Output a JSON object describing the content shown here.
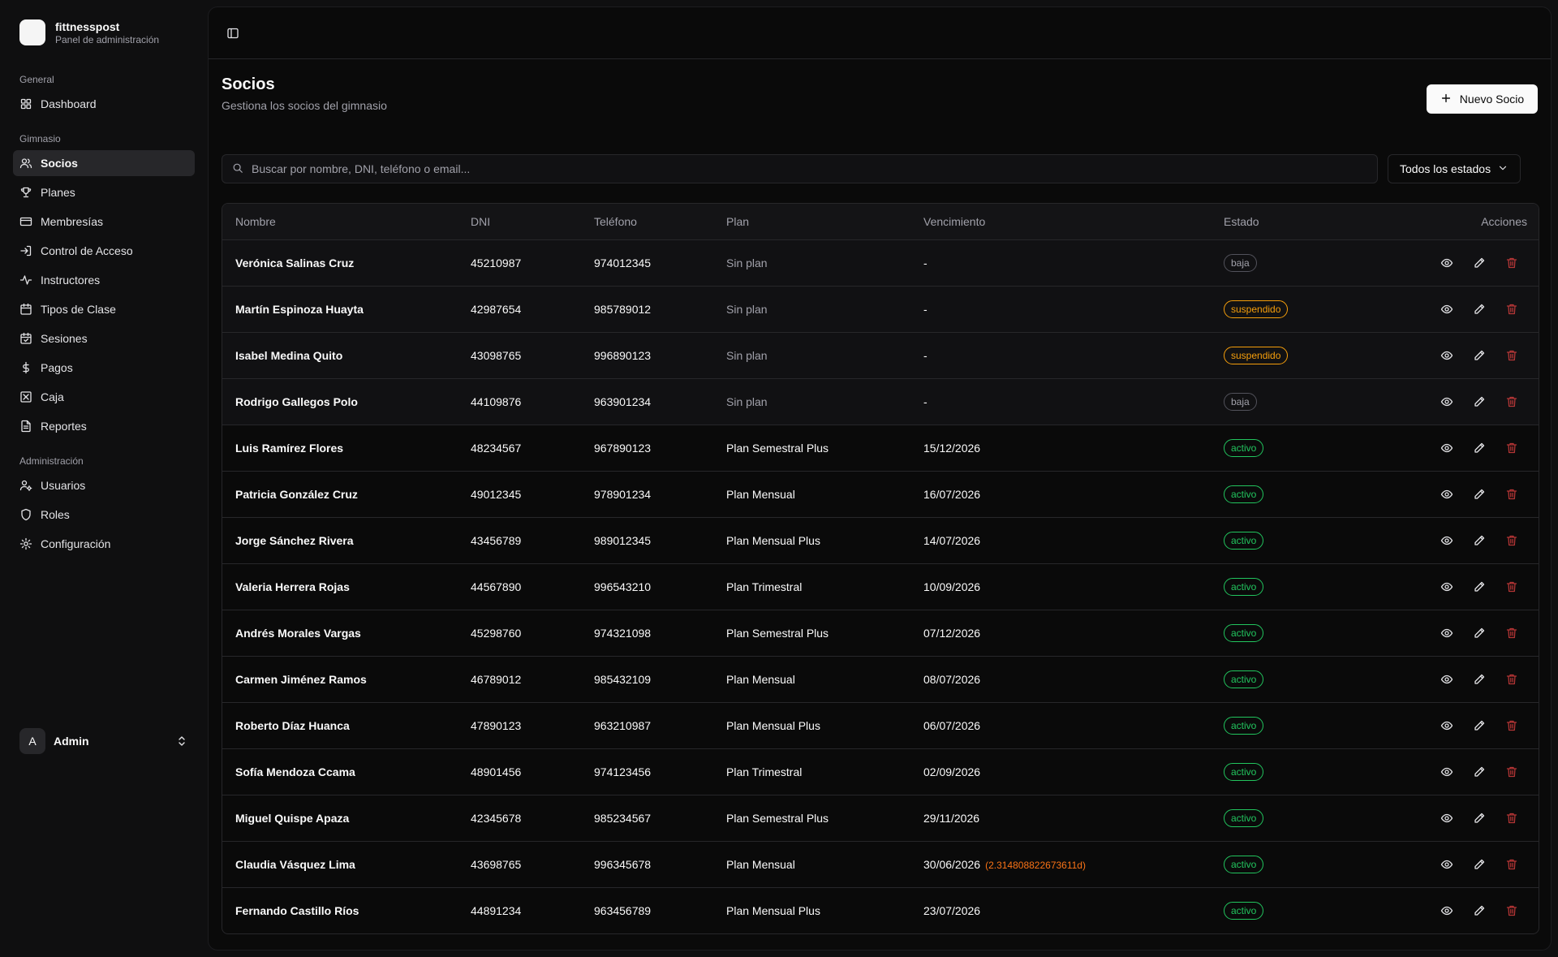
{
  "app": {
    "name": "fittnesspost",
    "subtitle": "Panel de administración"
  },
  "sidebar": {
    "groups": [
      {
        "label": "General",
        "items": [
          {
            "label": "Dashboard",
            "icon": "grid-icon"
          }
        ]
      },
      {
        "label": "Gimnasio",
        "items": [
          {
            "label": "Socios",
            "icon": "users-icon",
            "active": true
          },
          {
            "label": "Planes",
            "icon": "trophy-icon"
          },
          {
            "label": "Membresías",
            "icon": "card-icon"
          },
          {
            "label": "Control de Acceso",
            "icon": "login-icon"
          },
          {
            "label": "Instructores",
            "icon": "activity-icon"
          },
          {
            "label": "Tipos de Clase",
            "icon": "calendar-icon"
          },
          {
            "label": "Sesiones",
            "icon": "calendar-check-icon"
          },
          {
            "label": "Pagos",
            "icon": "dollar-icon"
          },
          {
            "label": "Caja",
            "icon": "cash-box-icon"
          },
          {
            "label": "Reportes",
            "icon": "file-icon"
          }
        ]
      },
      {
        "label": "Administración",
        "items": [
          {
            "label": "Usuarios",
            "icon": "user-cog-icon"
          },
          {
            "label": "Roles",
            "icon": "shield-icon"
          },
          {
            "label": "Configuración",
            "icon": "gear-icon"
          }
        ]
      }
    ],
    "user": {
      "initial": "A",
      "name": "Admin"
    }
  },
  "page": {
    "title": "Socios",
    "subtitle": "Gestiona los socios del gimnasio",
    "new_button": "Nuevo Socio",
    "search_placeholder": "Buscar por nombre, DNI, teléfono o email...",
    "status_filter": "Todos los estados"
  },
  "table": {
    "columns": [
      "Nombre",
      "DNI",
      "Teléfono",
      "Plan",
      "Vencimiento",
      "Estado",
      "Acciones"
    ],
    "rows": [
      {
        "nombre": "Verónica Salinas Cruz",
        "dni": "45210987",
        "telefono": "974012345",
        "plan": "Sin plan",
        "vencimiento": "-",
        "estado": "baja"
      },
      {
        "nombre": "Martín Espinoza Huayta",
        "dni": "42987654",
        "telefono": "985789012",
        "plan": "Sin plan",
        "vencimiento": "-",
        "estado": "suspendido"
      },
      {
        "nombre": "Isabel Medina Quito",
        "dni": "43098765",
        "telefono": "996890123",
        "plan": "Sin plan",
        "vencimiento": "-",
        "estado": "suspendido"
      },
      {
        "nombre": "Rodrigo Gallegos Polo",
        "dni": "44109876",
        "telefono": "963901234",
        "plan": "Sin plan",
        "vencimiento": "-",
        "estado": "baja"
      },
      {
        "nombre": "Luis Ramírez Flores",
        "dni": "48234567",
        "telefono": "967890123",
        "plan": "Plan Semestral Plus",
        "vencimiento": "15/12/2026",
        "estado": "activo"
      },
      {
        "nombre": "Patricia González Cruz",
        "dni": "49012345",
        "telefono": "978901234",
        "plan": "Plan Mensual",
        "vencimiento": "16/07/2026",
        "estado": "activo"
      },
      {
        "nombre": "Jorge Sánchez Rivera",
        "dni": "43456789",
        "telefono": "989012345",
        "plan": "Plan Mensual Plus",
        "vencimiento": "14/07/2026",
        "estado": "activo"
      },
      {
        "nombre": "Valeria Herrera Rojas",
        "dni": "44567890",
        "telefono": "996543210",
        "plan": "Plan Trimestral",
        "vencimiento": "10/09/2026",
        "estado": "activo"
      },
      {
        "nombre": "Andrés Morales Vargas",
        "dni": "45298760",
        "telefono": "974321098",
        "plan": "Plan Semestral Plus",
        "vencimiento": "07/12/2026",
        "estado": "activo"
      },
      {
        "nombre": "Carmen Jiménez Ramos",
        "dni": "46789012",
        "telefono": "985432109",
        "plan": "Plan Mensual",
        "vencimiento": "08/07/2026",
        "estado": "activo"
      },
      {
        "nombre": "Roberto Díaz Huanca",
        "dni": "47890123",
        "telefono": "963210987",
        "plan": "Plan Mensual Plus",
        "vencimiento": "06/07/2026",
        "estado": "activo"
      },
      {
        "nombre": "Sofía Mendoza Ccama",
        "dni": "48901456",
        "telefono": "974123456",
        "plan": "Plan Trimestral",
        "vencimiento": "02/09/2026",
        "estado": "activo"
      },
      {
        "nombre": "Miguel Quispe Apaza",
        "dni": "42345678",
        "telefono": "985234567",
        "plan": "Plan Semestral Plus",
        "vencimiento": "29/11/2026",
        "estado": "activo"
      },
      {
        "nombre": "Claudia Vásquez Lima",
        "dni": "43698765",
        "telefono": "996345678",
        "plan": "Plan Mensual",
        "vencimiento": "30/06/2026",
        "vencimiento_extra": "(2.31480882267361​1d)",
        "estado": "activo"
      },
      {
        "nombre": "Fernando Castillo Ríos",
        "dni": "44891234",
        "telefono": "963456789",
        "plan": "Plan Mensual Plus",
        "vencimiento": "23/07/2026",
        "estado": "activo"
      }
    ]
  },
  "colors": {
    "background": "#0a0a0a",
    "active_status": "#22c55e",
    "suspended_status": "#f59e0b",
    "inactive_status": "#a1a1aa",
    "delete_icon": "#ef4444",
    "warning_text": "#f97316"
  }
}
